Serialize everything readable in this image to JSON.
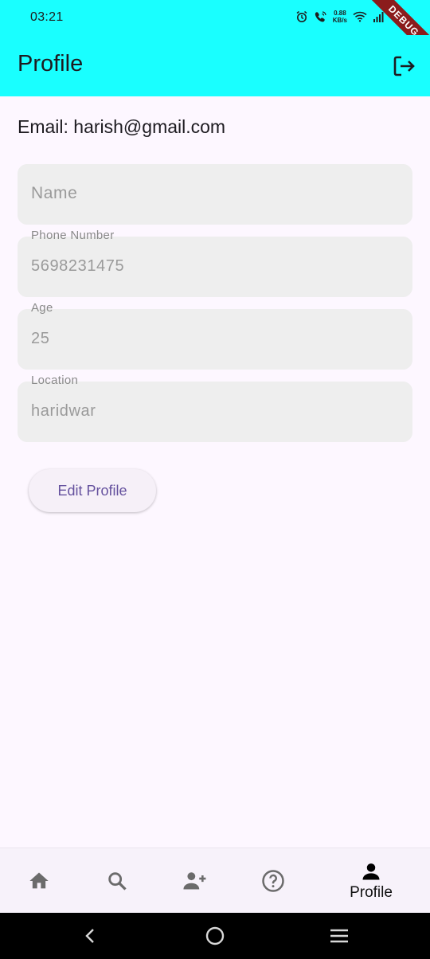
{
  "status_bar": {
    "time": "03:21",
    "net_speed_value": "0.88",
    "net_speed_unit": "KB/s",
    "debug_label": "DEBUG"
  },
  "app_bar": {
    "title": "Profile",
    "background": "#19ffff",
    "action_icon": "logout-icon"
  },
  "profile": {
    "email_line": "Email: harish@gmail.com",
    "fields": [
      {
        "label": "",
        "placeholder": "Name",
        "value": ""
      },
      {
        "label": "Phone Number",
        "value": "5698231475"
      },
      {
        "label": "Age",
        "value": "25"
      },
      {
        "label": "Location",
        "value": "haridwar"
      }
    ],
    "edit_button": "Edit Profile"
  },
  "bottom_nav": {
    "items": [
      {
        "icon": "home-icon",
        "label": ""
      },
      {
        "icon": "search-icon",
        "label": ""
      },
      {
        "icon": "add-person-icon",
        "label": ""
      },
      {
        "icon": "help-icon",
        "label": ""
      },
      {
        "icon": "person-icon",
        "label": "Profile",
        "selected": true
      }
    ]
  },
  "system_nav": {
    "icons": [
      "back-icon",
      "home-circle-icon",
      "recents-icon"
    ]
  }
}
